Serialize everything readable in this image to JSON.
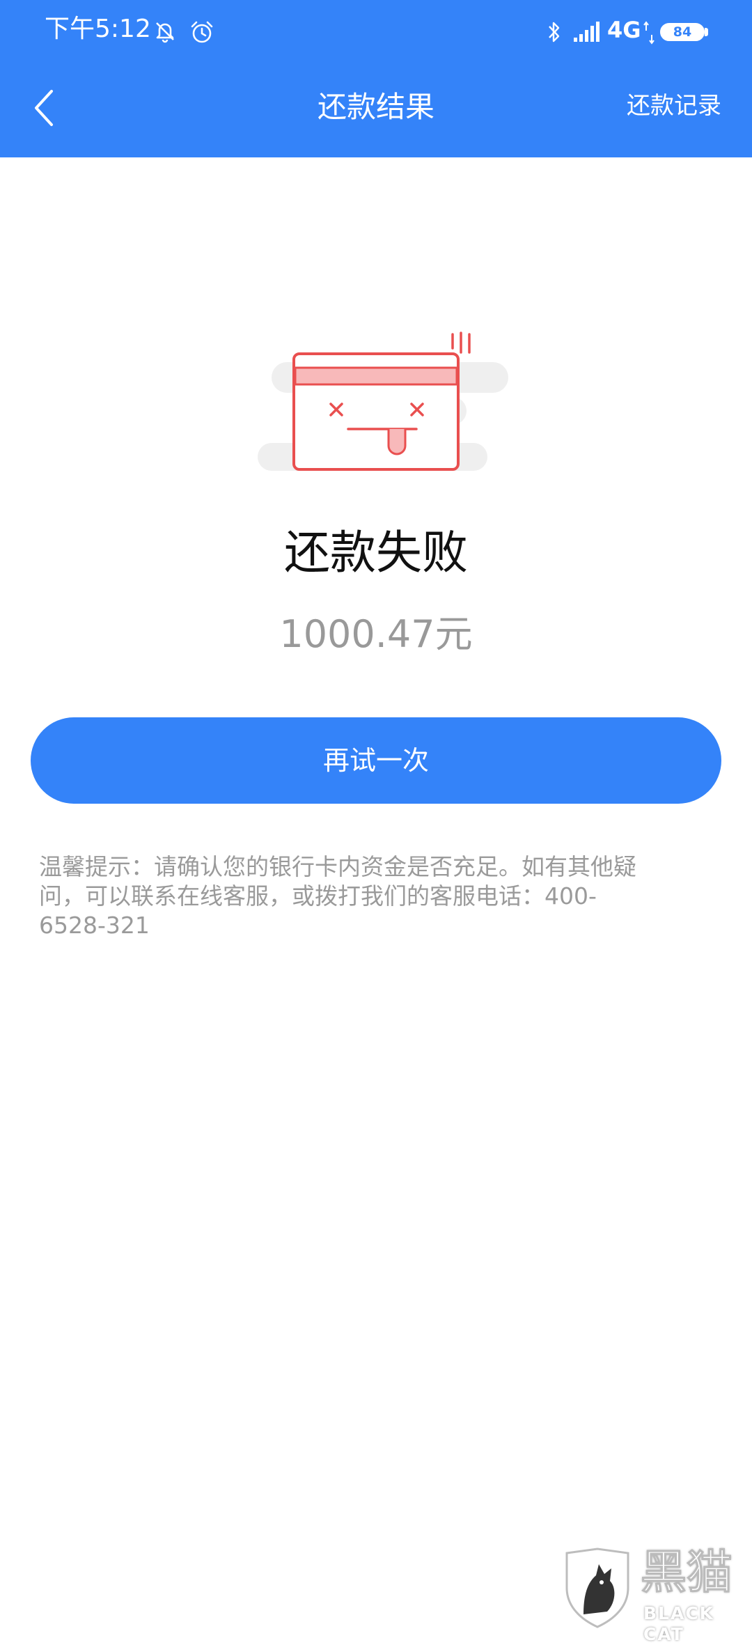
{
  "status_bar": {
    "time": "下午5:12",
    "network": "4G",
    "battery": "84",
    "icons": [
      "mute-bell-icon",
      "alarm-icon",
      "bluetooth-icon",
      "signal-icon",
      "data-arrows-icon",
      "battery-icon"
    ]
  },
  "nav": {
    "back_icon": "chevron-left-icon",
    "title": "还款结果",
    "records_label": "还款记录"
  },
  "result": {
    "illustration": "failed-card-icon",
    "title": "还款失败",
    "amount": "1000.47元"
  },
  "actions": {
    "retry_label": "再试一次"
  },
  "tips": {
    "text": "温馨提示：请确认您的银行卡内资金是否充足。如有其他疑问，可以联系在线客服，或拨打我们的客服电话：400-6528-321"
  },
  "watermark": {
    "title": "黑猫",
    "subtitle": "BLACK CAT"
  },
  "colors": {
    "primary": "#3483f9",
    "error_red": "#e94f4f",
    "error_pink": "#f8b9ba",
    "muted_text": "#999999",
    "title_text": "#111111"
  }
}
